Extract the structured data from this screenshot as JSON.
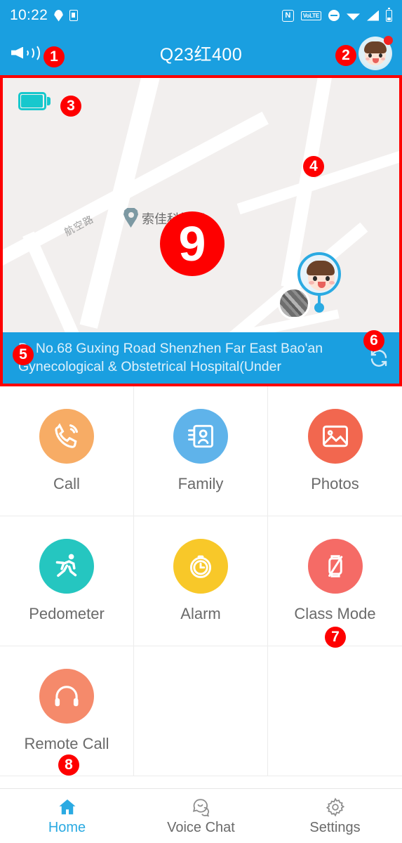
{
  "statusbar": {
    "time": "10:22",
    "icons_left": [
      "location-pin-icon",
      "sim-card-icon"
    ],
    "icons_right": [
      "nfc-icon",
      "volte-icon",
      "do-not-disturb-icon",
      "wifi-icon",
      "cellular-signal-icon",
      "battery-icon"
    ],
    "nfc_label": "N",
    "volte_label": "VoLTE"
  },
  "header": {
    "title": "Q23红400",
    "speaker_icon": "speaker-volume-icon",
    "avatar_icon": "child-avatar",
    "has_notification_dot": true,
    "background_color": "#1a9fe0"
  },
  "map": {
    "device_battery_icon": "device-battery-icon",
    "street_label": "航空路",
    "poi_label": "索佳科技园",
    "kid_marker_icon": "child-location-marker",
    "photo_marker_icon": "photo-location-marker",
    "background_color": "#f2efee"
  },
  "address": {
    "text": "D. No.68 Guxing Road Shenzhen Far East Bao'an Gynecological & Obstetrical Hospital(Under",
    "refresh_icon": "refresh-icon"
  },
  "grid": {
    "items": [
      {
        "label": "Call",
        "icon": "phone-call-icon",
        "color": "#f7ac65"
      },
      {
        "label": "Family",
        "icon": "contact-card-icon",
        "color": "#5fb3ea"
      },
      {
        "label": "Photos",
        "icon": "photo-image-icon",
        "color": "#f2674f"
      },
      {
        "label": "Pedometer",
        "icon": "running-man-icon",
        "color": "#25c6c0"
      },
      {
        "label": "Alarm",
        "icon": "alarm-clock-icon",
        "color": "#f8c829"
      },
      {
        "label": "Class Mode",
        "icon": "watch-disabled-icon",
        "color": "#f56b66"
      },
      {
        "label": "Remote Call",
        "icon": "headphones-icon",
        "color": "#f58a6b"
      },
      {
        "label": "",
        "icon": "",
        "color": ""
      },
      {
        "label": "",
        "icon": "",
        "color": ""
      }
    ]
  },
  "bottomnav": {
    "items": [
      {
        "label": "Home",
        "icon": "home-icon",
        "active": true
      },
      {
        "label": "Voice Chat",
        "icon": "chat-bubbles-icon",
        "active": false
      },
      {
        "label": "Settings",
        "icon": "gear-icon",
        "active": false
      }
    ],
    "active_color": "#2aaae2"
  },
  "annotations": {
    "color": "#fe0000",
    "markers": [
      {
        "id": "1",
        "target": "speaker-button"
      },
      {
        "id": "2",
        "target": "avatar-button"
      },
      {
        "id": "3",
        "target": "device-battery"
      },
      {
        "id": "4",
        "target": "child-location-marker"
      },
      {
        "id": "5",
        "target": "address-text"
      },
      {
        "id": "6",
        "target": "refresh-button"
      },
      {
        "id": "7",
        "target": "class-mode-cell"
      },
      {
        "id": "8",
        "target": "remote-call-cell"
      },
      {
        "id": "9",
        "target": "map-area"
      }
    ]
  }
}
